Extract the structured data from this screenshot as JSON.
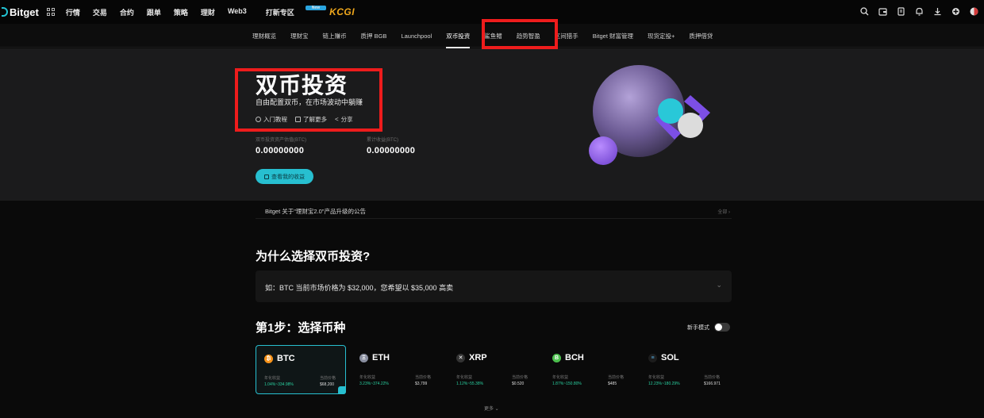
{
  "topbar": {
    "logo": "Bitget",
    "nav": [
      "行情",
      "交易",
      "合约",
      "跟单",
      "策略",
      "理财",
      "Web3",
      "打新专区"
    ],
    "new_badge": "New",
    "promo": "KCGI",
    "icons": [
      "search-icon",
      "wallet-icon",
      "document-icon",
      "bell-icon",
      "download-icon",
      "globe-icon",
      "avatar"
    ]
  },
  "subnav": {
    "items": [
      "理财概览",
      "理财宝",
      "链上赚币",
      "质押 BGB",
      "Launchpool",
      "双币投资",
      "鲨鱼鳍",
      "趋势智盈",
      "区间猎手",
      "Bitget 财富管理",
      "现货定投+",
      "质押借贷"
    ]
  },
  "hero": {
    "title": "双币投资",
    "subtitle": "自由配置双币，在市场波动中躺赚",
    "links": [
      "入门教程",
      "了解更多",
      "分享"
    ],
    "stat1_label": "双币投资资产估值(BTC)",
    "stat1_value": "0.00000000",
    "stat2_label": "累计收益(BTC)",
    "stat2_value": "0.00000000",
    "button": "查看我的收益"
  },
  "announcement": {
    "text": "Bitget 关于\"理财宝2.0\"产品升级的公告",
    "more": "全部 ›"
  },
  "why": {
    "title": "为什么选择双币投资?",
    "example": "如：BTC 当前市场价格为 $32,000，您希望以 $35,000 高卖"
  },
  "step": {
    "title": "第1步：选择币种",
    "newbie_label": "新手模式"
  },
  "coins": [
    {
      "symbol": "BTC",
      "icon": "₿",
      "color": "#f7931a",
      "apr_label": "年化收益",
      "apr": "1.04%~334.98%",
      "price_label": "当前价格",
      "price": "$68,200"
    },
    {
      "symbol": "ETH",
      "icon": "Ξ",
      "color": "#8a8fa0",
      "apr_label": "年化收益",
      "apr": "3.23%~374.22%",
      "price_label": "当前价格",
      "price": "$3,799"
    },
    {
      "symbol": "XRP",
      "icon": "✕",
      "color": "#333",
      "apr_label": "年化收益",
      "apr": "1.12%~55.38%",
      "price_label": "当前价格",
      "price": "$0.520"
    },
    {
      "symbol": "BCH",
      "icon": "B",
      "color": "#4cc04e",
      "apr_label": "年化收益",
      "apr": "1.87%~150.80%",
      "price_label": "当前价格",
      "price": "$485"
    },
    {
      "symbol": "SOL",
      "icon": "≡",
      "color": "#1c1c1c",
      "apr_label": "年化收益",
      "apr": "12.23%~180.29%",
      "price_label": "当前价格",
      "price": "$166.971"
    }
  ],
  "more_bottom": "更多 ⌄",
  "colors": {
    "accent": "#27bfd0",
    "highlight": "#ee1c1c"
  }
}
